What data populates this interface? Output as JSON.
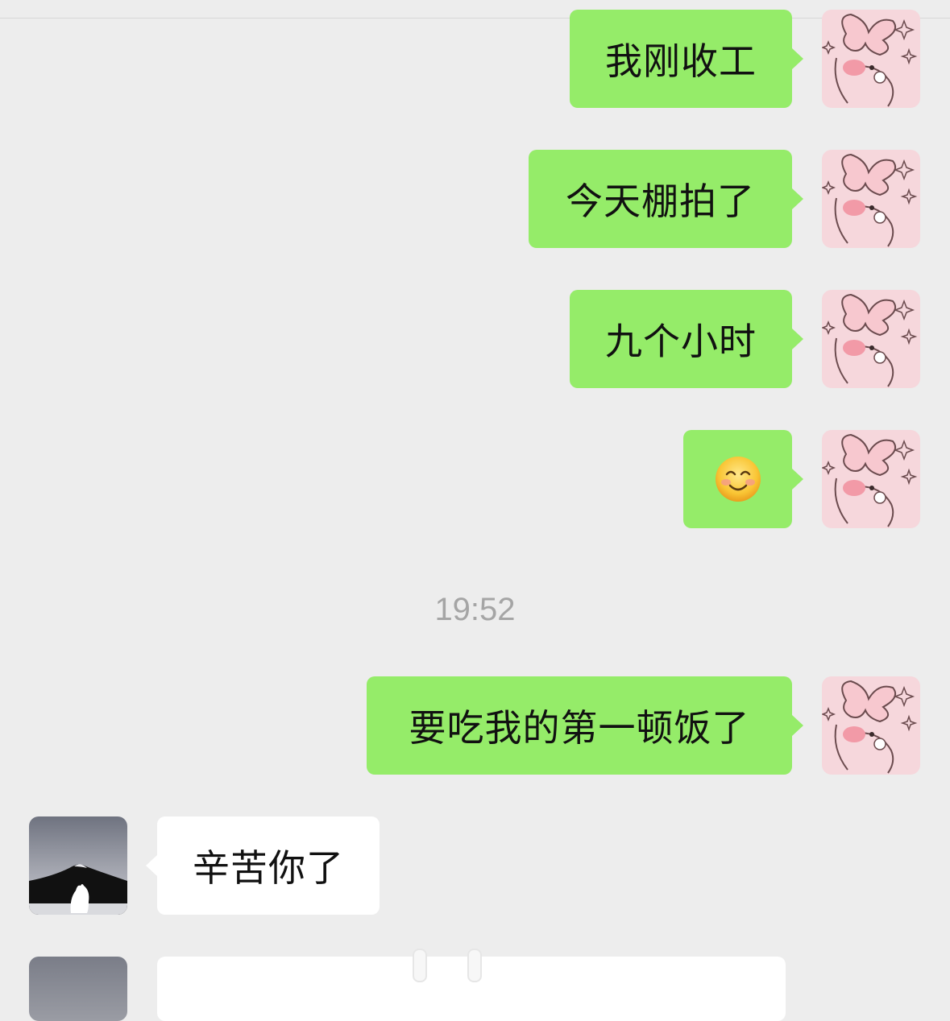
{
  "messages": [
    {
      "from": "me",
      "text": "我刚收工"
    },
    {
      "from": "me",
      "text": "今天棚拍了"
    },
    {
      "from": "me",
      "text": "九个小时"
    },
    {
      "from": "me",
      "emoji": "smiling-face-with-blush"
    },
    {
      "from": "me",
      "text": "要吃我的第一顿饭了"
    },
    {
      "from": "other",
      "text": "辛苦你了"
    }
  ],
  "timestamp": "19:52",
  "colors": {
    "background": "#ededed",
    "my_bubble": "#95ec69",
    "other_bubble": "#ffffff",
    "timestamp": "#a5a5a5"
  }
}
